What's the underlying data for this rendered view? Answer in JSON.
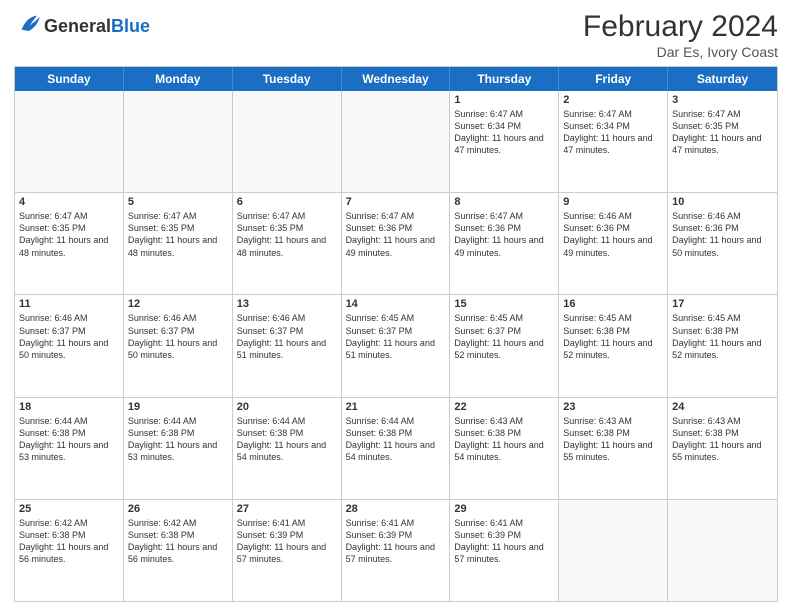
{
  "header": {
    "logo_general": "General",
    "logo_blue": "Blue",
    "month_year": "February 2024",
    "location": "Dar Es, Ivory Coast"
  },
  "weekdays": [
    "Sunday",
    "Monday",
    "Tuesday",
    "Wednesday",
    "Thursday",
    "Friday",
    "Saturday"
  ],
  "rows": [
    [
      {
        "day": "",
        "info": ""
      },
      {
        "day": "",
        "info": ""
      },
      {
        "day": "",
        "info": ""
      },
      {
        "day": "",
        "info": ""
      },
      {
        "day": "1",
        "info": "Sunrise: 6:47 AM\nSunset: 6:34 PM\nDaylight: 11 hours and 47 minutes."
      },
      {
        "day": "2",
        "info": "Sunrise: 6:47 AM\nSunset: 6:34 PM\nDaylight: 11 hours and 47 minutes."
      },
      {
        "day": "3",
        "info": "Sunrise: 6:47 AM\nSunset: 6:35 PM\nDaylight: 11 hours and 47 minutes."
      }
    ],
    [
      {
        "day": "4",
        "info": "Sunrise: 6:47 AM\nSunset: 6:35 PM\nDaylight: 11 hours and 48 minutes."
      },
      {
        "day": "5",
        "info": "Sunrise: 6:47 AM\nSunset: 6:35 PM\nDaylight: 11 hours and 48 minutes."
      },
      {
        "day": "6",
        "info": "Sunrise: 6:47 AM\nSunset: 6:35 PM\nDaylight: 11 hours and 48 minutes."
      },
      {
        "day": "7",
        "info": "Sunrise: 6:47 AM\nSunset: 6:36 PM\nDaylight: 11 hours and 49 minutes."
      },
      {
        "day": "8",
        "info": "Sunrise: 6:47 AM\nSunset: 6:36 PM\nDaylight: 11 hours and 49 minutes."
      },
      {
        "day": "9",
        "info": "Sunrise: 6:46 AM\nSunset: 6:36 PM\nDaylight: 11 hours and 49 minutes."
      },
      {
        "day": "10",
        "info": "Sunrise: 6:46 AM\nSunset: 6:36 PM\nDaylight: 11 hours and 50 minutes."
      }
    ],
    [
      {
        "day": "11",
        "info": "Sunrise: 6:46 AM\nSunset: 6:37 PM\nDaylight: 11 hours and 50 minutes."
      },
      {
        "day": "12",
        "info": "Sunrise: 6:46 AM\nSunset: 6:37 PM\nDaylight: 11 hours and 50 minutes."
      },
      {
        "day": "13",
        "info": "Sunrise: 6:46 AM\nSunset: 6:37 PM\nDaylight: 11 hours and 51 minutes."
      },
      {
        "day": "14",
        "info": "Sunrise: 6:45 AM\nSunset: 6:37 PM\nDaylight: 11 hours and 51 minutes."
      },
      {
        "day": "15",
        "info": "Sunrise: 6:45 AM\nSunset: 6:37 PM\nDaylight: 11 hours and 52 minutes."
      },
      {
        "day": "16",
        "info": "Sunrise: 6:45 AM\nSunset: 6:38 PM\nDaylight: 11 hours and 52 minutes."
      },
      {
        "day": "17",
        "info": "Sunrise: 6:45 AM\nSunset: 6:38 PM\nDaylight: 11 hours and 52 minutes."
      }
    ],
    [
      {
        "day": "18",
        "info": "Sunrise: 6:44 AM\nSunset: 6:38 PM\nDaylight: 11 hours and 53 minutes."
      },
      {
        "day": "19",
        "info": "Sunrise: 6:44 AM\nSunset: 6:38 PM\nDaylight: 11 hours and 53 minutes."
      },
      {
        "day": "20",
        "info": "Sunrise: 6:44 AM\nSunset: 6:38 PM\nDaylight: 11 hours and 54 minutes."
      },
      {
        "day": "21",
        "info": "Sunrise: 6:44 AM\nSunset: 6:38 PM\nDaylight: 11 hours and 54 minutes."
      },
      {
        "day": "22",
        "info": "Sunrise: 6:43 AM\nSunset: 6:38 PM\nDaylight: 11 hours and 54 minutes."
      },
      {
        "day": "23",
        "info": "Sunrise: 6:43 AM\nSunset: 6:38 PM\nDaylight: 11 hours and 55 minutes."
      },
      {
        "day": "24",
        "info": "Sunrise: 6:43 AM\nSunset: 6:38 PM\nDaylight: 11 hours and 55 minutes."
      }
    ],
    [
      {
        "day": "25",
        "info": "Sunrise: 6:42 AM\nSunset: 6:38 PM\nDaylight: 11 hours and 56 minutes."
      },
      {
        "day": "26",
        "info": "Sunrise: 6:42 AM\nSunset: 6:38 PM\nDaylight: 11 hours and 56 minutes."
      },
      {
        "day": "27",
        "info": "Sunrise: 6:41 AM\nSunset: 6:39 PM\nDaylight: 11 hours and 57 minutes."
      },
      {
        "day": "28",
        "info": "Sunrise: 6:41 AM\nSunset: 6:39 PM\nDaylight: 11 hours and 57 minutes."
      },
      {
        "day": "29",
        "info": "Sunrise: 6:41 AM\nSunset: 6:39 PM\nDaylight: 11 hours and 57 minutes."
      },
      {
        "day": "",
        "info": ""
      },
      {
        "day": "",
        "info": ""
      }
    ]
  ]
}
